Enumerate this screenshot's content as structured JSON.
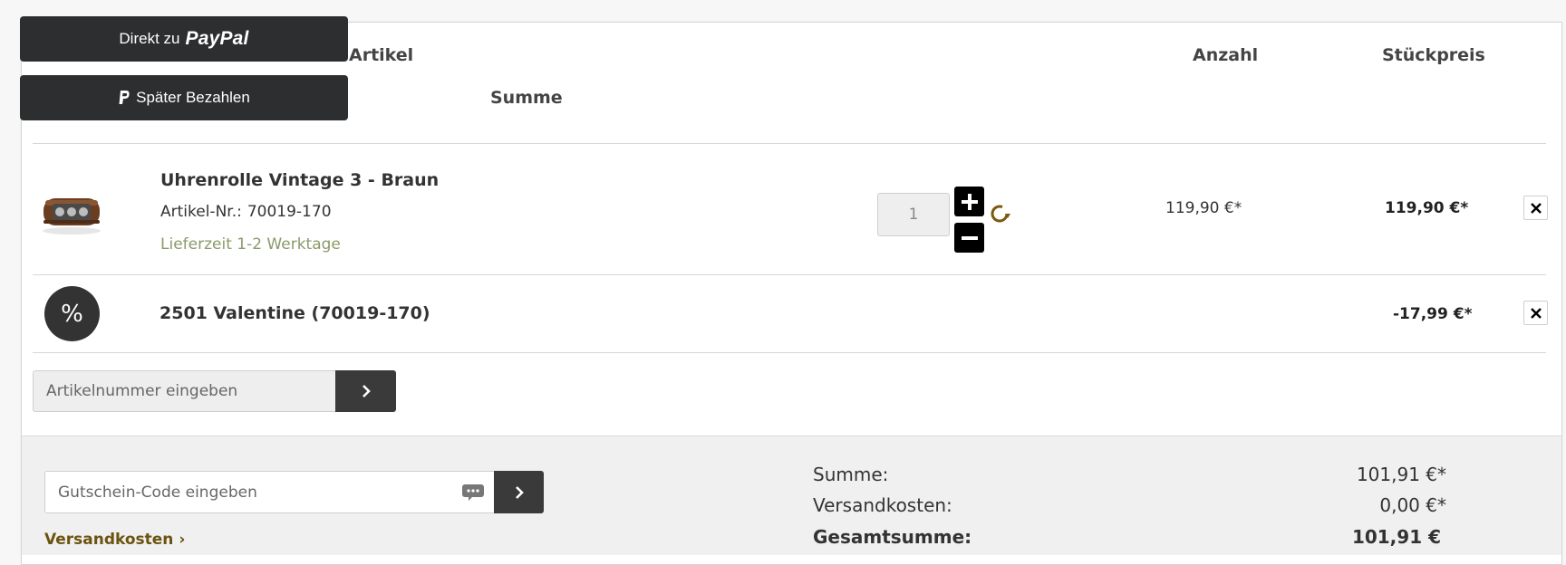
{
  "paypal": {
    "direct_prefix": "Direkt zu",
    "direct_brand": "PayPal",
    "later_label": "Später Bezahlen"
  },
  "table_header": {
    "article": "Artikel",
    "quantity": "Anzahl",
    "unit_price": "Stückpreis",
    "total": "Summe"
  },
  "line_item": {
    "title": "Uhrenrolle Vintage 3 - Braun",
    "sku_label": "Artikel-Nr.:",
    "sku": "70019-170",
    "delivery": "Lieferzeit 1-2 Werktage",
    "quantity": "1",
    "unit_price": "119,90 €*",
    "total_price": "119,90 €*"
  },
  "voucher_line": {
    "symbol": "%",
    "name": "2501 Valentine (70019-170)",
    "amount": "-17,99 €*"
  },
  "article_number_input": {
    "placeholder": "Artikelnummer eingeben"
  },
  "coupon_input": {
    "placeholder": "Gutschein-Code eingeben"
  },
  "shipping_link": "Versandkosten ›",
  "summary": {
    "subtotal_label": "Summe:",
    "subtotal_value": "101,91 €*",
    "shipping_label": "Versandkosten:",
    "shipping_value": "0,00 €*",
    "grand_total_label": "Gesamtsumme:",
    "grand_total_value": "101,91 €"
  },
  "colors": {
    "paypal_button": "#2c2e2f",
    "delivery_text": "#8a9a6a",
    "link_brown": "#6b5310",
    "refresh_icon": "#7a5a10"
  },
  "icons": {
    "qty_increase": "plus-icon",
    "qty_decrease": "minus-icon",
    "update": "refresh-icon",
    "remove": "close-icon",
    "submit": "chevron-right-icon",
    "coupon_hint": "chat-bubble-icon"
  }
}
